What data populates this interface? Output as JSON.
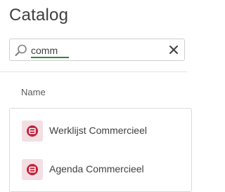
{
  "header": {
    "title": "Catalog"
  },
  "search": {
    "value": "comm",
    "placeholder": "",
    "icon": "search-icon",
    "clear_icon": "close-icon"
  },
  "table": {
    "column_header": "Name",
    "items": [
      {
        "label": "Werklijst Commercieel",
        "icon": "app-icon"
      },
      {
        "label": "Agenda Commercieel",
        "icon": "app-icon"
      }
    ]
  },
  "colors": {
    "accent_underline": "#2b8a3e",
    "app_icon_background": "#f3dfe3",
    "app_icon_foreground": "#c0223b"
  }
}
